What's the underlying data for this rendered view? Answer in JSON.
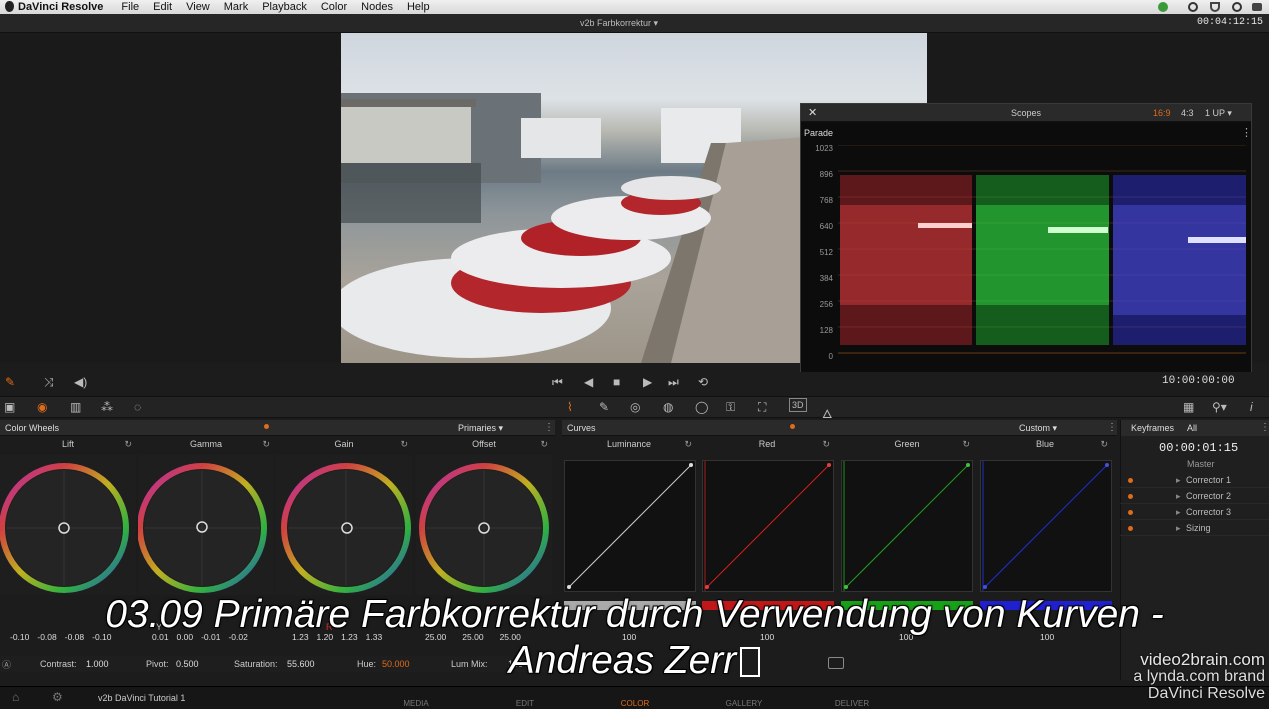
{
  "menubar": {
    "app": "DaVinci Resolve",
    "items": [
      "File",
      "Edit",
      "View",
      "Mark",
      "Playback",
      "Color",
      "Nodes",
      "Help"
    ]
  },
  "titlebar": {
    "project": "v2b Farbkorrektur",
    "timecode": "00:04:12:15"
  },
  "scopes": {
    "title": "Scopes",
    "mode": "Parade",
    "aspect_options": [
      "16:9",
      "4:3"
    ],
    "aspect_active": "16:9",
    "layout": "1 UP",
    "scale": [
      "1023",
      "896",
      "768",
      "640",
      "512",
      "384",
      "256",
      "128",
      "0"
    ]
  },
  "transport": {
    "timecode": "10:00:00:00"
  },
  "colorwheels": {
    "title": "Color Wheels",
    "mode": "Primaries",
    "wheels": [
      {
        "name": "Lift",
        "values": [
          "-0.10",
          "-0.08",
          "-0.08",
          "-0.10"
        ]
      },
      {
        "name": "Gamma",
        "values": [
          "0.01",
          "0.00",
          "-0.01",
          "-0.02"
        ]
      },
      {
        "name": "Gain",
        "values": [
          "1.23",
          "1.20",
          "1.23",
          "1.33"
        ]
      },
      {
        "name": "Offset",
        "values": [
          "25.00",
          "25.00",
          "25.00"
        ]
      }
    ],
    "channel_labels": [
      "Y",
      "R"
    ],
    "params": {
      "contrast_label": "Contrast:",
      "contrast": "1.000",
      "pivot_label": "Pivot:",
      "pivot": "0.500",
      "saturation_label": "Saturation:",
      "saturation": "55.600",
      "hue_label": "Hue:",
      "hue": "50.000",
      "lummix_label": "Lum Mix:",
      "lummix": "100"
    }
  },
  "curves": {
    "title": "Curves",
    "mode": "Custom",
    "channels": [
      {
        "name": "Luminance",
        "color": "#cccccc",
        "value": "100"
      },
      {
        "name": "Red",
        "color": "#d02020",
        "value": "100"
      },
      {
        "name": "Green",
        "color": "#20a020",
        "value": "100"
      },
      {
        "name": "Blue",
        "color": "#2030d0",
        "value": "100"
      }
    ]
  },
  "keyframes": {
    "title": "Keyframes",
    "filter": "All",
    "timecode": "00:00:01:15",
    "master": "Master",
    "rows": [
      "Corrector 1",
      "Corrector 2",
      "Corrector 3",
      "Sizing"
    ]
  },
  "bottombar": {
    "project": "v2b DaVinci Tutorial 1",
    "tabs": [
      "MEDIA",
      "EDIT",
      "COLOR",
      "GALLERY",
      "DELIVER"
    ],
    "active": "COLOR"
  },
  "overlay": {
    "subtitle_line1": "03.09 Primäre Farbkorrektur durch Verwendung von Kurven -",
    "subtitle_line2": "Andreas Zerr",
    "watermark1": "video2brain.com",
    "watermark2": "a lynda.com brand",
    "watermark3": "DaVinci Resolve"
  },
  "colors": {
    "accent": "#e06b1a",
    "panel": "#2a2a2a"
  }
}
